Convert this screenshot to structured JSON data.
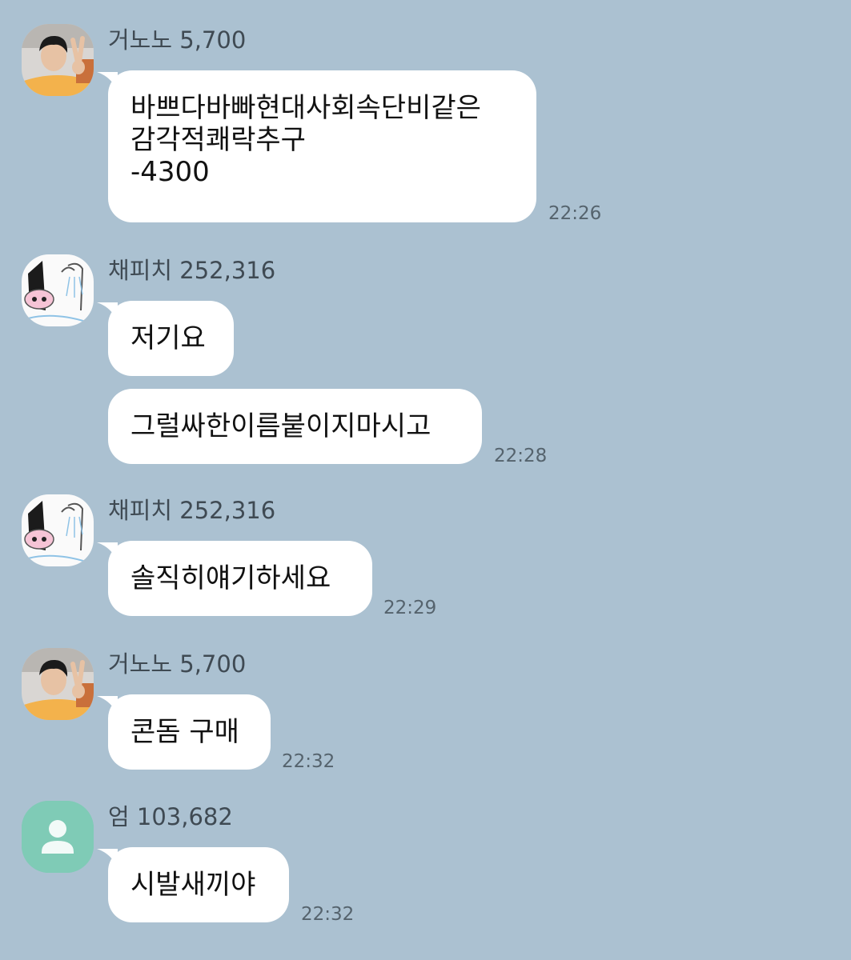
{
  "messages": [
    {
      "sender": "거노노 5,700",
      "bubbles": [
        {
          "lines": [
            "바쁘다바빠현대사회속단비같은",
            "감각적쾌락추구",
            "-4300"
          ]
        }
      ],
      "time": "22:26",
      "avatar": "photo-avatar"
    },
    {
      "sender": "채피치 252,316",
      "bubbles": [
        {
          "lines": [
            "저기요"
          ]
        },
        {
          "lines": [
            "그럴싸한이름붙이지마시고"
          ]
        }
      ],
      "time": "22:28",
      "avatar": "apeach-sticker-avatar"
    },
    {
      "sender": "채피치 252,316",
      "bubbles": [
        {
          "lines": [
            "솔직히얘기하세요"
          ]
        }
      ],
      "time": "22:29",
      "avatar": "apeach-sticker-avatar"
    },
    {
      "sender": "거노노 5,700",
      "bubbles": [
        {
          "lines": [
            "콘돔 구매"
          ]
        }
      ],
      "time": "22:32",
      "avatar": "photo-avatar"
    },
    {
      "sender": "엄 103,682",
      "bubbles": [
        {
          "lines": [
            "시발새끼야"
          ]
        }
      ],
      "time": "22:32",
      "avatar": "default-profile-icon"
    }
  ],
  "colors": {
    "background": "#abc1d1",
    "bubble": "#ffffff",
    "default_avatar": "#7fcbb6"
  }
}
